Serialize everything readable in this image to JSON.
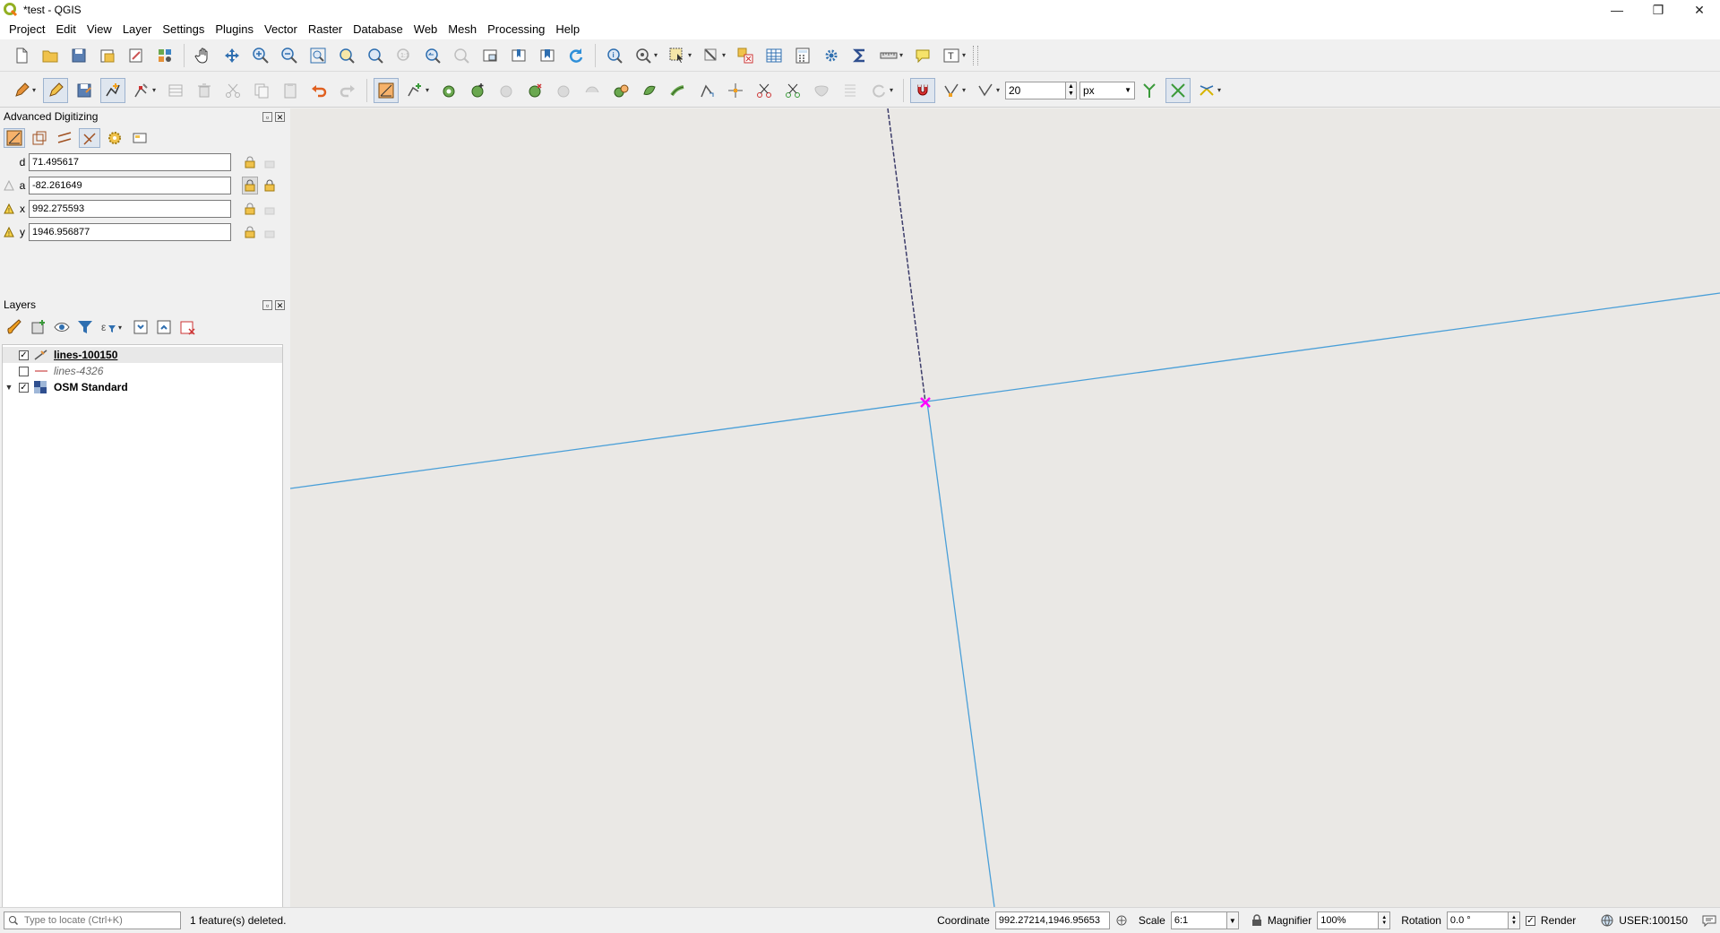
{
  "window": {
    "title": "*test - QGIS",
    "controls": {
      "minimize": "—",
      "restore": "❐",
      "close": "✕"
    }
  },
  "menu": [
    "Project",
    "Edit",
    "View",
    "Layer",
    "Settings",
    "Plugins",
    "Vector",
    "Raster",
    "Database",
    "Web",
    "Mesh",
    "Processing",
    "Help"
  ],
  "snapping": {
    "tolerance": "20",
    "units": "px"
  },
  "advanced_digitizing": {
    "title": "Advanced Digitizing",
    "fields": [
      {
        "label": "d",
        "value": "71.495617"
      },
      {
        "label": "a",
        "value": "-82.261649"
      },
      {
        "label": "x",
        "value": "992.275593"
      },
      {
        "label": "y",
        "value": "1946.956877"
      }
    ]
  },
  "layers": {
    "title": "Layers",
    "items": [
      {
        "name": "lines-100150",
        "checked": true
      },
      {
        "name": "lines-4326",
        "checked": false
      },
      {
        "name": "OSM Standard",
        "checked": true
      }
    ]
  },
  "status": {
    "locator_placeholder": "Type to locate (Ctrl+K)",
    "message": "1 feature(s) deleted.",
    "coordinate_label": "Coordinate",
    "coordinate": "992.27214,1946.95653",
    "scale_label": "Scale",
    "scale": "6:1",
    "magnifier_label": "Magnifier",
    "magnifier": "100%",
    "rotation_label": "Rotation",
    "rotation": "0.0 °",
    "render_label": "Render",
    "crs": "USER:100150"
  },
  "colors": {
    "map_background": "#eae8e5",
    "line": "#4a9fd8",
    "vertex_marker": "#ff00ff",
    "rubberband": "#3c3c6a"
  }
}
